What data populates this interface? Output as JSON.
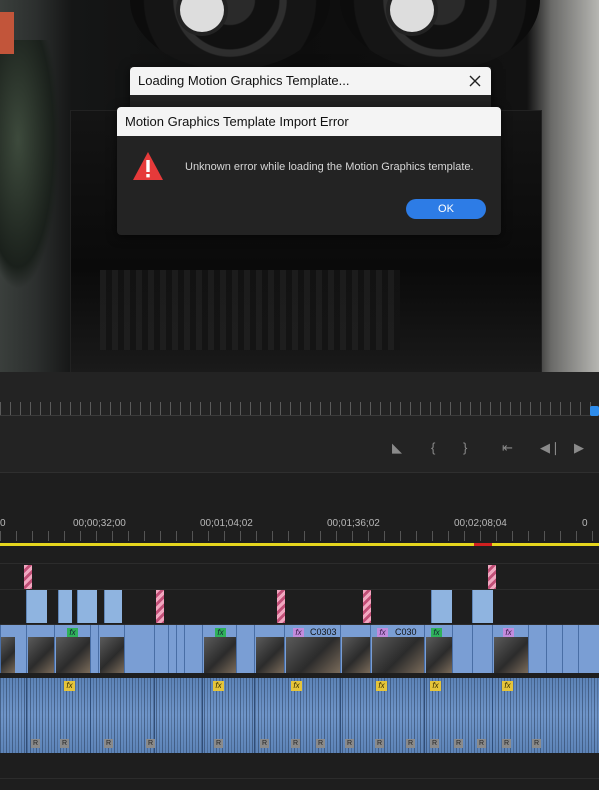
{
  "dialogs": {
    "loading": {
      "title": "Loading Motion Graphics Template..."
    },
    "error": {
      "title": "Motion Graphics Template Import Error",
      "message": "Unknown error while loading the Motion Graphics template.",
      "ok_label": "OK"
    }
  },
  "timeline": {
    "timecodes": [
      "0",
      "00;00;32;00",
      "00;01;04;02",
      "00;01;36;02",
      "00;02;08;04",
      "0"
    ],
    "clip_labels": [
      "C0303",
      "C030"
    ],
    "fx_label": "fx",
    "audio_badge": "R"
  },
  "colors": {
    "error_icon": "#e63a3a",
    "ok_button": "#2d7ce6",
    "video_clip": "#7a9ed4",
    "work_area": "#e6d61e"
  }
}
